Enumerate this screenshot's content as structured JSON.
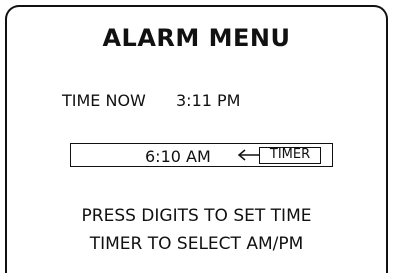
{
  "screen": {
    "title": "ALARM MENU"
  },
  "current_time": {
    "label": "TIME NOW",
    "value": "3:11 PM"
  },
  "alarm": {
    "time_value": "6:10 AM",
    "timer_key_label": "TIMER",
    "arrow_icon": "left-arrow-icon"
  },
  "instructions": {
    "line1": "PRESS DIGITS TO SET TIME",
    "line2": "TIMER TO SELECT AM/PM"
  }
}
